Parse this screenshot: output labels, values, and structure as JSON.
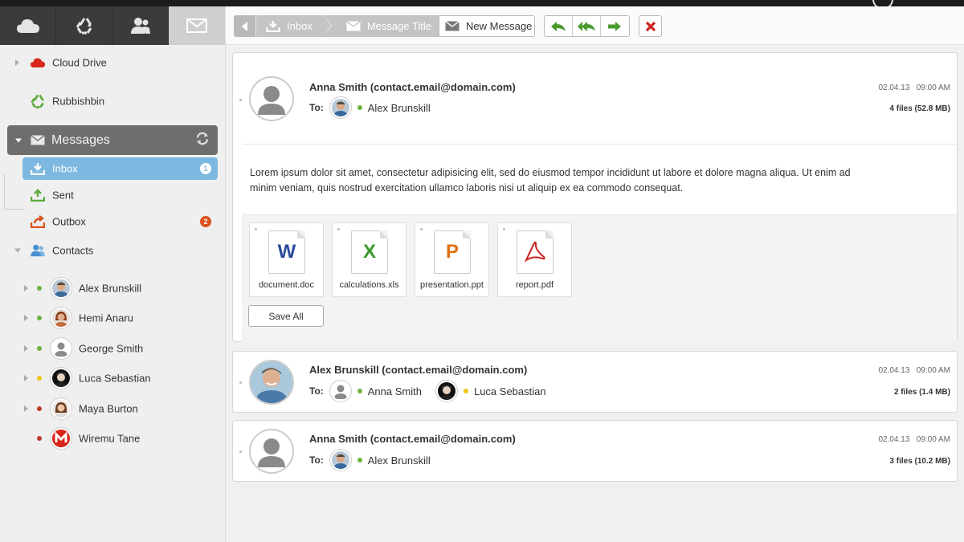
{
  "colors": {
    "accent_blue": "#7cb8e0",
    "online": "#6cb33f",
    "away": "#f2c41a",
    "busy": "#c0392b",
    "cloud_red": "#d9261c",
    "recycle_green": "#5aaa3a",
    "reply_green": "#4a9b2e",
    "delete_red": "#cc2222"
  },
  "app_tabs": [
    {
      "name": "cloud-icon"
    },
    {
      "name": "recycle-icon"
    },
    {
      "name": "contacts-icon"
    },
    {
      "name": "mail-icon"
    }
  ],
  "sidebar": {
    "cloud_drive": "Cloud Drive",
    "rubbishbin": "Rubbishbin",
    "messages": "Messages",
    "inbox": "Inbox",
    "inbox_badge": "1",
    "sent": "Sent",
    "outbox": "Outbox",
    "outbox_badge": "2",
    "contacts": "Contacts",
    "contact_list": [
      {
        "name": "Alex Brunskill",
        "status": "online"
      },
      {
        "name": "Hemi Anaru",
        "status": "online"
      },
      {
        "name": "George Smith",
        "status": "online"
      },
      {
        "name": "Luca Sebastian",
        "status": "away"
      },
      {
        "name": "Maya Burton",
        "status": "busy"
      },
      {
        "name": "Wiremu Tane",
        "status": "busy"
      }
    ]
  },
  "toolbar": {
    "breadcrumb_inbox": "Inbox",
    "breadcrumb_title": "Message Title",
    "new_message": "New Message"
  },
  "messages": [
    {
      "sender": "Anna Smith (contact.email@domain.com)",
      "to_label": "To:",
      "recipients": [
        {
          "name": "Alex Brunskill",
          "status": "online"
        }
      ],
      "date": "02.04.13",
      "time": "09:00 AM",
      "files": "4 files (52.8 MB)",
      "body": "Lorem ipsum dolor sit amet, consectetur adipisicing elit, sed do eiusmod tempor incididunt ut labore et dolore magna aliqua. Ut enim ad minim veniam, quis nostrud exercitation ullamco laboris nisi ut aliquip ex ea commodo consequat.",
      "attachments": [
        {
          "file": "document.doc",
          "letter": "W",
          "color": "#2a4a9a"
        },
        {
          "file": "calculations.xls",
          "letter": "X",
          "color": "#3a9a2a"
        },
        {
          "file": "presentation.ppt",
          "letter": "P",
          "color": "#e07010"
        },
        {
          "file": "report.pdf",
          "letter": "",
          "color": "#cc2222"
        }
      ],
      "save_all": "Save All"
    },
    {
      "sender": "Alex Brunskill (contact.email@domain.com)",
      "to_label": "To:",
      "recipients": [
        {
          "name": "Anna Smith",
          "status": "online"
        },
        {
          "name": "Luca Sebastian",
          "status": "away"
        }
      ],
      "date": "02.04.13",
      "time": "09:00 AM",
      "files": "2 files (1.4 MB)"
    },
    {
      "sender": "Anna Smith (contact.email@domain.com)",
      "to_label": "To:",
      "recipients": [
        {
          "name": "Alex Brunskill",
          "status": "online"
        }
      ],
      "date": "02.04.13",
      "time": "09:00 AM",
      "files": "3 files (10.2 MB)"
    }
  ]
}
